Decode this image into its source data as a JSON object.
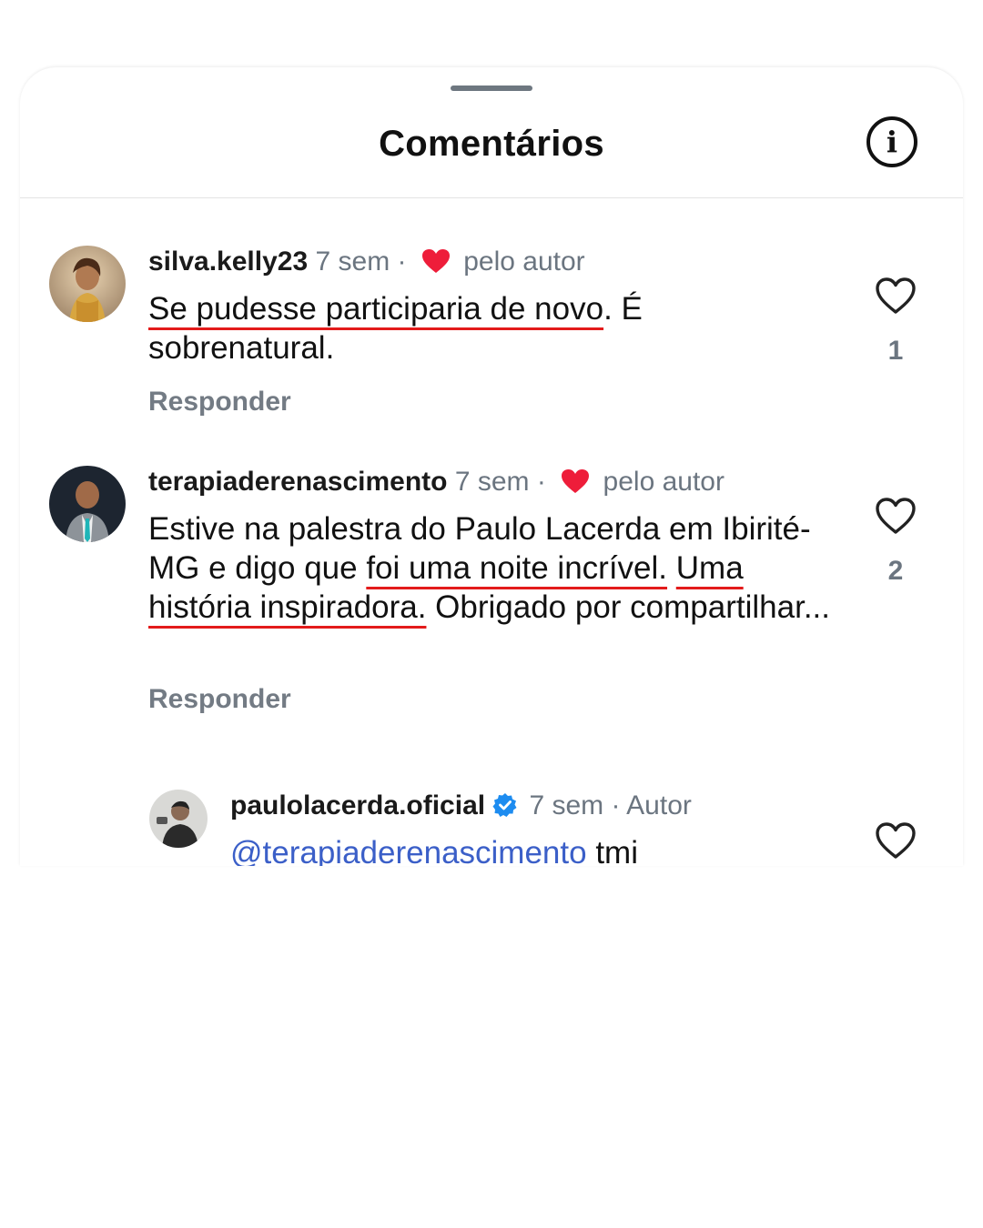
{
  "sheet": {
    "title": "Comentários",
    "info_icon": "info-circle-icon"
  },
  "comments": [
    {
      "username": "silva.kelly23",
      "time": "7 sem",
      "separator": "·",
      "liked_by_author_label": "pelo autor",
      "text_underlined": "Se pudesse participaria de novo",
      "text_rest": ". É sobrenatural.",
      "reply_label": "Responder",
      "like_count": "1"
    },
    {
      "username": "terapiaderenascimento",
      "time": "7 sem",
      "separator": "·",
      "liked_by_author_label": "pelo autor",
      "text_part1": "Estive na palestra do Paulo Lacerda em Ibirité-MG e digo que ",
      "text_underlined1": "foi uma noite incrível.",
      "text_underlined2": "Uma história inspiradora.",
      "text_part2": " Obrigado por compartilhar...",
      "reply_label": "Responder",
      "like_count": "2"
    },
    {
      "username": "paulolacerda.oficial",
      "verified": true,
      "time": "7 sem",
      "separator": "·",
      "author_label": "Autor",
      "mention": "@terapiaderenascimento",
      "text_rest": " tmi"
    }
  ],
  "colors": {
    "heart_red": "#ee1d3a",
    "underline_red": "#e31b1b",
    "mention_blue": "#3b5fc8",
    "verified_blue": "#1d8cf0",
    "muted_gray": "#6b7580"
  }
}
